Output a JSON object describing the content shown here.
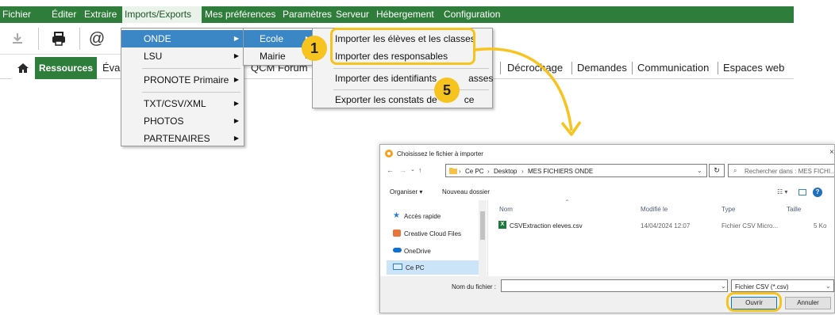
{
  "menubar": {
    "items": [
      "Fichier",
      "Éditer",
      "Extraire",
      "Imports/Exports",
      "Mes préférences",
      "Paramètres",
      "Serveur",
      "Hébergement",
      "Configuration"
    ]
  },
  "tabs": {
    "resources": "Ressources",
    "eval_partial": "Éval",
    "qcm_partial": "QCM",
    "forum_partial": "Forum",
    "items_after": [
      "Décrochage",
      "Demandes",
      "Communication",
      "Espaces web"
    ]
  },
  "imports_menu": {
    "items": [
      "ONDE",
      "LSU",
      "PRONOTE Primaire",
      "TXT/CSV/XML",
      "PHOTOS",
      "PARTENAIRES"
    ]
  },
  "onde_submenu": {
    "items": [
      "Ecole",
      "Mairie"
    ]
  },
  "ecole_submenu": {
    "items": [
      "Importer les élèves et les classes",
      "Importer des responsables",
      "Importer des identifiants des classes",
      "Exporter les constats de présence"
    ],
    "visible": [
      "Importer les élèves et les classes",
      "Importer des responsables",
      "Importer des identifiants",
      "asses",
      "Exporter les constats de",
      "ce"
    ]
  },
  "badges": {
    "b1": "1",
    "b2": "2",
    "b5": "5"
  },
  "dialog": {
    "title": "Choisissez le fichier à importer",
    "breadcrumb": [
      "Ce PC",
      "Desktop",
      "MES FICHIERS ONDE"
    ],
    "search_placeholder": "Rechercher dans : MES FICHI...",
    "organize": "Organiser ▾",
    "new_folder": "Nouveau dossier",
    "columns": {
      "name": "Nom",
      "modified": "Modifié le",
      "type": "Type",
      "size": "Taille"
    },
    "sidebar": [
      "Accès rapide",
      "Creative Cloud Files",
      "OneDrive",
      "Ce PC"
    ],
    "file": {
      "name": "CSVExtraction eleves.csv",
      "modified": "14/04/2024 12:07",
      "type": "Fichier CSV Micro...",
      "size": "5 Ko"
    },
    "filename_label": "Nom du fichier :",
    "filetype": "Fichier CSV (*.csv)",
    "open_label": "Ouvrir",
    "cancel_label": "Annuler"
  },
  "colors": {
    "green": "#2f7d3b",
    "yellow": "#f7c31e",
    "blue_sel": "#3b86c4"
  }
}
